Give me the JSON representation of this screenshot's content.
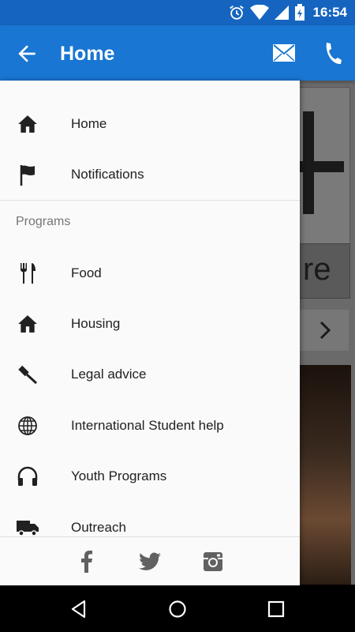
{
  "status_bar": {
    "time": "16:54",
    "icons": [
      "alarm-icon",
      "wifi-icon",
      "signal-icon",
      "battery-charging-icon"
    ]
  },
  "app_bar": {
    "title": "Home",
    "back_icon": "arrow-left-icon",
    "actions": [
      "mail-icon",
      "phone-icon"
    ]
  },
  "background_page": {
    "card_text": "re"
  },
  "drawer": {
    "top_items": [
      {
        "label": "Home",
        "icon": "home-icon"
      },
      {
        "label": "Notifications",
        "icon": "flag-icon"
      }
    ],
    "section_header": "Programs",
    "program_items": [
      {
        "label": "Food",
        "icon": "fork-knife-icon"
      },
      {
        "label": "Housing",
        "icon": "home-icon"
      },
      {
        "label": "Legal advice",
        "icon": "gavel-icon"
      },
      {
        "label": "International Student help",
        "icon": "globe-icon"
      },
      {
        "label": "Youth Programs",
        "icon": "headphones-icon"
      },
      {
        "label": "Outreach",
        "icon": "truck-icon"
      }
    ],
    "footer_social": [
      "facebook-icon",
      "twitter-icon",
      "instagram-icon"
    ]
  },
  "nav_bar": {
    "buttons": [
      "back-triangle-icon",
      "home-circle-icon",
      "recents-square-icon"
    ]
  },
  "colors": {
    "status_bar": "#1565c0",
    "app_bar": "#1976d2",
    "drawer_bg": "#fafafa",
    "icon": "#212121"
  }
}
